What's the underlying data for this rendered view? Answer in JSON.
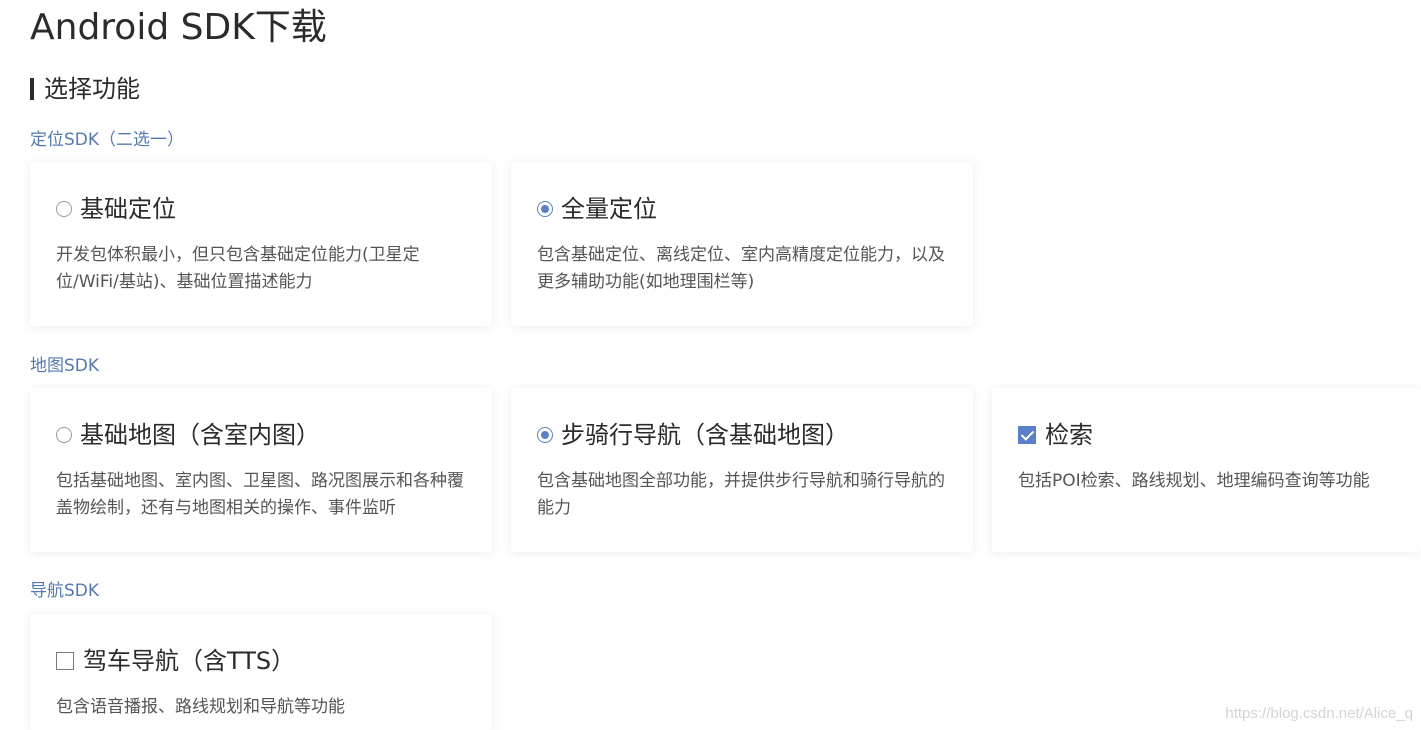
{
  "page": {
    "title": "Android SDK下载",
    "section_title": "选择功能"
  },
  "groups": [
    {
      "label": "定位SDK（二选一）",
      "options": [
        {
          "control": "radio",
          "checked": false,
          "title": "基础定位",
          "description": "开发包体积最小，但只包含基础定位能力(卫星定位/WiFi/基站)、基础位置描述能力"
        },
        {
          "control": "radio",
          "checked": true,
          "title": "全量定位",
          "description": "包含基础定位、离线定位、室内高精度定位能力，以及更多辅助功能(如地理围栏等)"
        }
      ]
    },
    {
      "label": "地图SDK",
      "options": [
        {
          "control": "radio",
          "checked": false,
          "title": "基础地图（含室内图）",
          "description": "包括基础地图、室内图、卫星图、路况图展示和各种覆盖物绘制，还有与地图相关的操作、事件监听"
        },
        {
          "control": "radio",
          "checked": true,
          "title": "步骑行导航（含基础地图）",
          "description": "包含基础地图全部功能，并提供步行导航和骑行导航的能力"
        },
        {
          "control": "checkbox",
          "checked": true,
          "title": "检索",
          "description": "包括POI检索、路线规划、地理编码查询等功能"
        }
      ]
    },
    {
      "label": "导航SDK",
      "options": [
        {
          "control": "checkbox",
          "checked": false,
          "title": "驾车导航（含TTS）",
          "description": "包含语音播报、路线规划和导航等功能"
        }
      ]
    }
  ],
  "watermark": "https://blog.csdn.net/Alice_q",
  "colors": {
    "accent": "#5b7fc8",
    "group_label": "#5479b0",
    "title_text": "#2b2b2b",
    "description_text": "#555555"
  }
}
